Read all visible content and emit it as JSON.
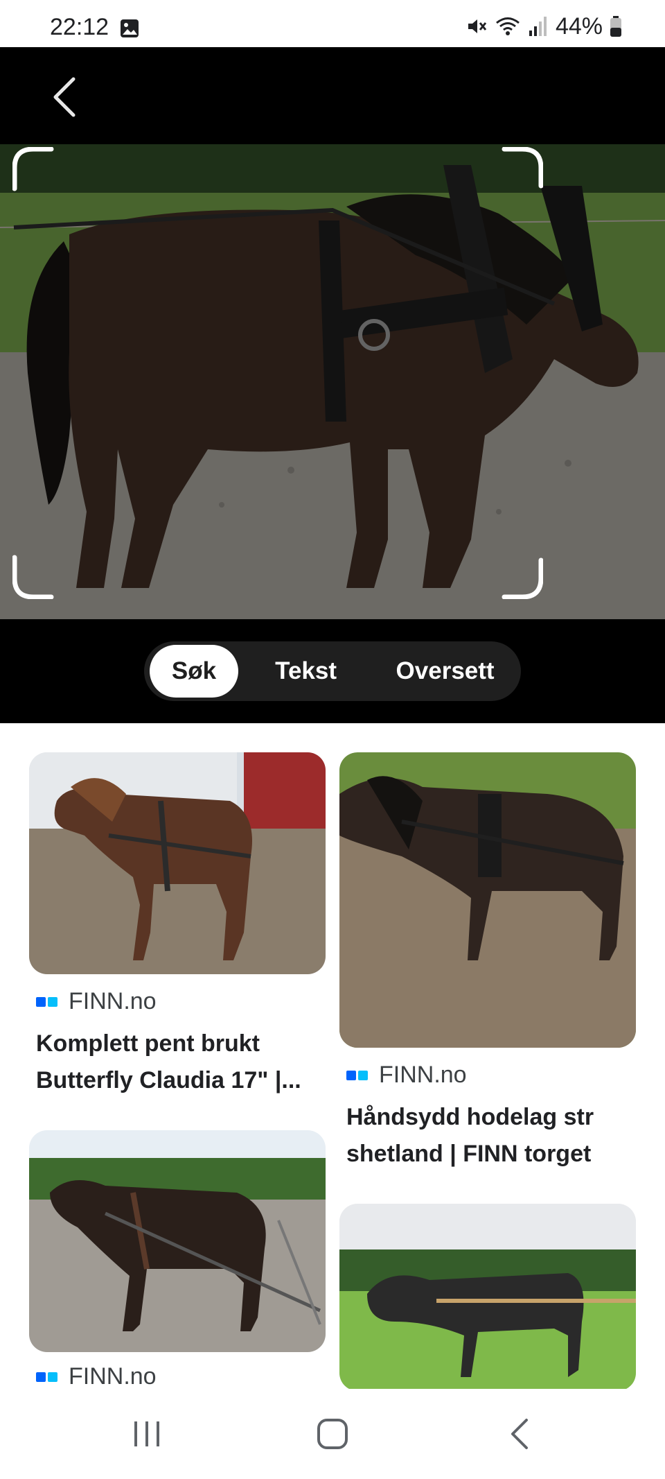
{
  "status_bar": {
    "time": "22:12",
    "battery": "44%",
    "icons": [
      "gallery-icon",
      "mute-icon",
      "wifi-icon",
      "signal-icon",
      "battery-icon"
    ]
  },
  "lens": {
    "back_icon": "chevron-left-icon",
    "tabs": [
      {
        "label": "Søk",
        "active": true
      },
      {
        "label": "Tekst",
        "active": false
      },
      {
        "label": "Oversett",
        "active": false
      }
    ]
  },
  "results": [
    {
      "source": "FINN.no",
      "title_line1": "Komplett pent brukt",
      "title_line2": "Butterfly Claudia 17\" |..."
    },
    {
      "source": "FINN.no",
      "title_line1": "Håndsydd hodelag str",
      "title_line2": "shetland | FINN torget"
    },
    {
      "source": "FINN.no",
      "title_line1": "",
      "title_line2": ""
    },
    {
      "source": "",
      "title_line1": "",
      "title_line2": ""
    }
  ],
  "colors": {
    "finn_dark_blue": "#0063fb",
    "finn_light_blue": "#06befb",
    "pill_active": "#ffffff",
    "pill_bg": "#1f1f1f"
  },
  "nav_bar": {
    "icons": [
      "recent-apps-icon",
      "home-icon",
      "back-icon"
    ]
  }
}
